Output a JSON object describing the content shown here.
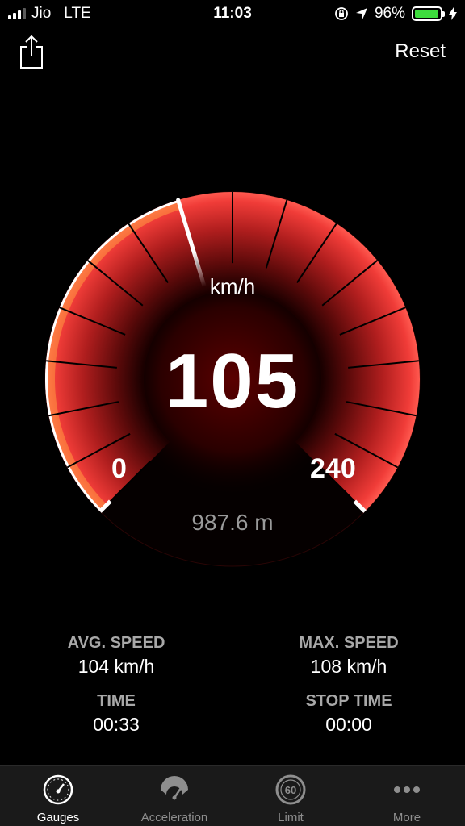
{
  "status_bar": {
    "carrier": "Jio",
    "network": "LTE",
    "time": "11:03",
    "battery": "96%",
    "battery_level": 0.96
  },
  "nav": {
    "reset_label": "Reset"
  },
  "gauge": {
    "unit": "km/h",
    "speed": "105",
    "min": "0",
    "max": "240",
    "distance": "987.6 m",
    "speed_value": 105,
    "min_value": 0,
    "max_value": 240,
    "accent_color": "#e8302e"
  },
  "stats": {
    "avg_speed_label": "AVG. SPEED",
    "avg_speed": "104 km/h",
    "max_speed_label": "MAX. SPEED",
    "max_speed": "108 km/h",
    "time_label": "TIME",
    "time": "00:33",
    "stop_time_label": "STOP TIME",
    "stop_time": "00:00"
  },
  "tabs": [
    {
      "label": "Gauges",
      "icon": "gauge-icon",
      "active": true
    },
    {
      "label": "Acceleration",
      "icon": "acceleration-icon",
      "active": false
    },
    {
      "label": "Limit",
      "icon": "limit-60-icon",
      "active": false
    },
    {
      "label": "More",
      "icon": "more-dots-icon",
      "active": false
    }
  ],
  "limit_sign_text": "60"
}
